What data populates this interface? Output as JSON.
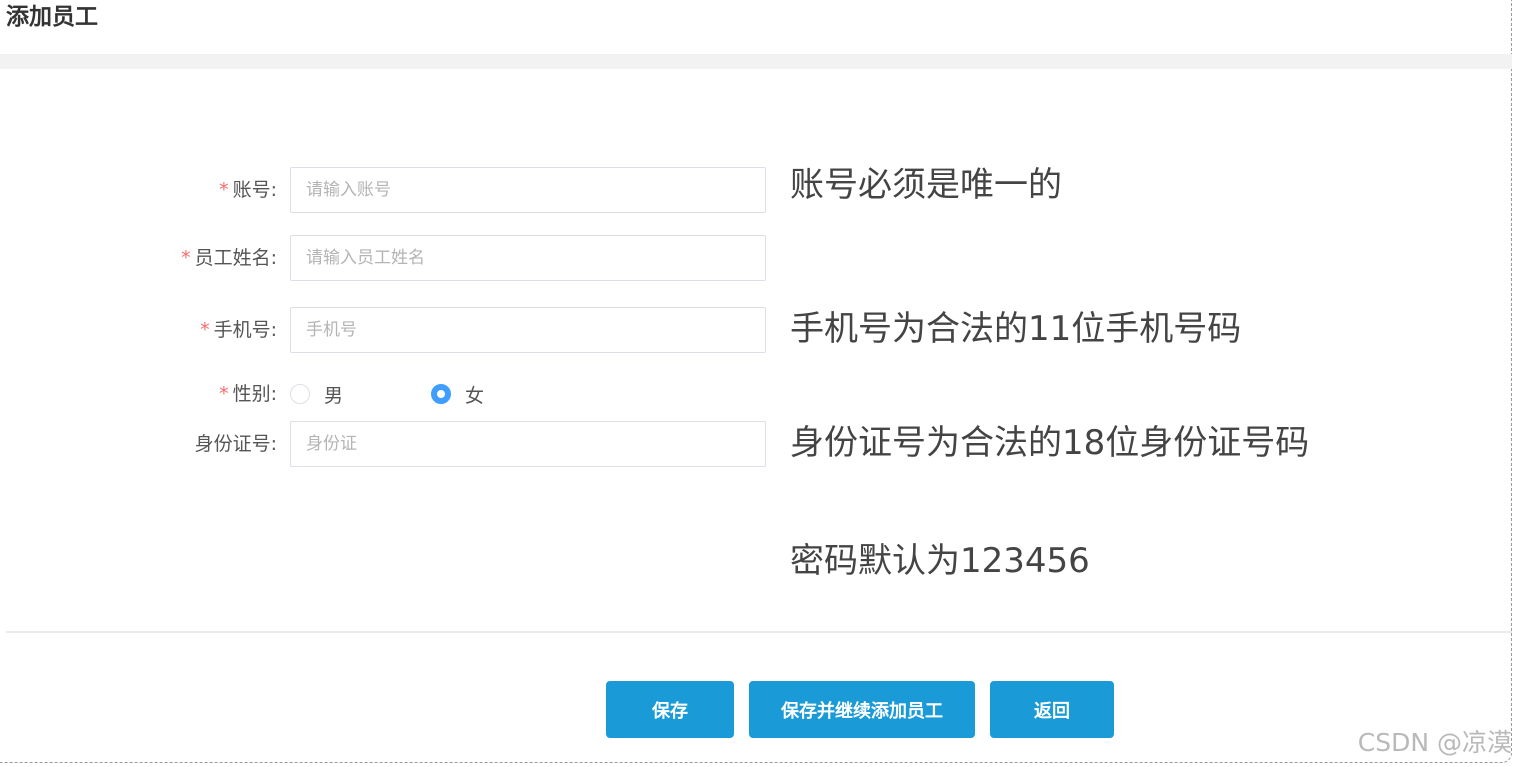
{
  "page": {
    "title": "添加员工"
  },
  "form": {
    "account": {
      "label": "账号:",
      "required_mark": "*",
      "placeholder": "请输入账号",
      "value": ""
    },
    "name": {
      "label": "员工姓名:",
      "required_mark": "*",
      "placeholder": "请输入员工姓名",
      "value": ""
    },
    "phone": {
      "label": "手机号:",
      "required_mark": "*",
      "placeholder": "手机号",
      "value": ""
    },
    "gender": {
      "label": "性别:",
      "required_mark": "*",
      "options": [
        {
          "label": "男",
          "checked": false
        },
        {
          "label": "女",
          "checked": true
        }
      ]
    },
    "id_card": {
      "label": "身份证号:",
      "placeholder": "身份证",
      "value": ""
    }
  },
  "hints": {
    "account": "账号必须是唯一的",
    "phone": "手机号为合法的11位手机号码",
    "id_card": "身份证号为合法的18位身份证号码",
    "password": "密码默认为123456"
  },
  "buttons": {
    "save": "保存",
    "save_continue": "保存并继续添加员工",
    "back": "返回"
  },
  "watermark": "CSDN @凉漠",
  "colors": {
    "primary_button": "#1a9ad6",
    "radio_checked": "#409eff",
    "required": "#f56c6c",
    "section_bar": "#f2f2f2"
  }
}
